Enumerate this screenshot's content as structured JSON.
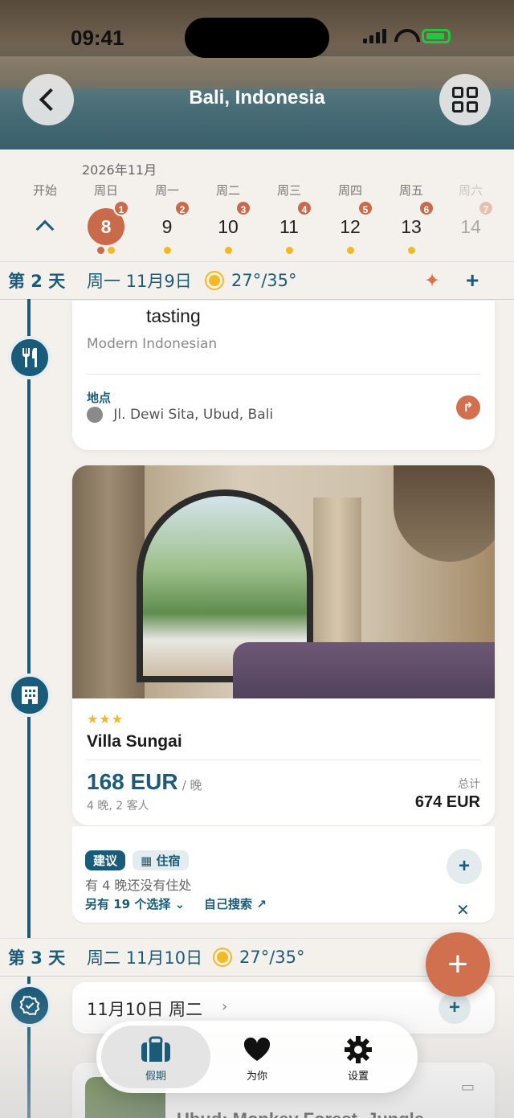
{
  "status_bar": {
    "time": "09:41"
  },
  "header": {
    "title": "Bali, Indonesia"
  },
  "calendar": {
    "month": "2026年11月",
    "start_label": "开始",
    "days": [
      {
        "weekday": "周日",
        "day": "8",
        "badge": "1",
        "selected": true
      },
      {
        "weekday": "周一",
        "day": "9",
        "badge": "2"
      },
      {
        "weekday": "周二",
        "day": "10",
        "badge": "3"
      },
      {
        "weekday": "周三",
        "day": "11",
        "badge": "4"
      },
      {
        "weekday": "周四",
        "day": "12",
        "badge": "5"
      },
      {
        "weekday": "周五",
        "day": "13",
        "badge": "6"
      },
      {
        "weekday": "周六",
        "day": "14",
        "badge": "7"
      }
    ]
  },
  "day2": {
    "label": "第 2 天",
    "date": "周一 11月9日",
    "temp": "27°/35°"
  },
  "restaurant": {
    "title": "tasting",
    "cuisine": "Modern Indonesian",
    "location_label": "地点",
    "address": "Jl. Dewi Sita, Ubud, Bali"
  },
  "villa": {
    "stars": "★★★",
    "name": "Villa Sungai",
    "price": "168 EUR",
    "per_night": "/ 晚",
    "details": "4 晚, 2 客人",
    "total_label": "总计",
    "total": "674 EUR"
  },
  "suggestion": {
    "chip_suggest": "建议",
    "chip_stay": "住宿",
    "message": "有 4 晚还没有住处",
    "more": "另有 19 个选择",
    "search": "自己搜索 ↗"
  },
  "day3": {
    "label": "第 3 天",
    "date": "周二 11月10日",
    "temp": "27°/35°",
    "card_title": "11月10日 周二"
  },
  "next_card": {
    "title": "Ubud: Monkey Forest, Jungle"
  },
  "tabbar": {
    "tab1": "假期",
    "tab2": "为你",
    "tab3": "设置"
  },
  "colors": {
    "accent": "#1b5b7a",
    "brand": "#c96a4b",
    "star": "#f1b927"
  }
}
